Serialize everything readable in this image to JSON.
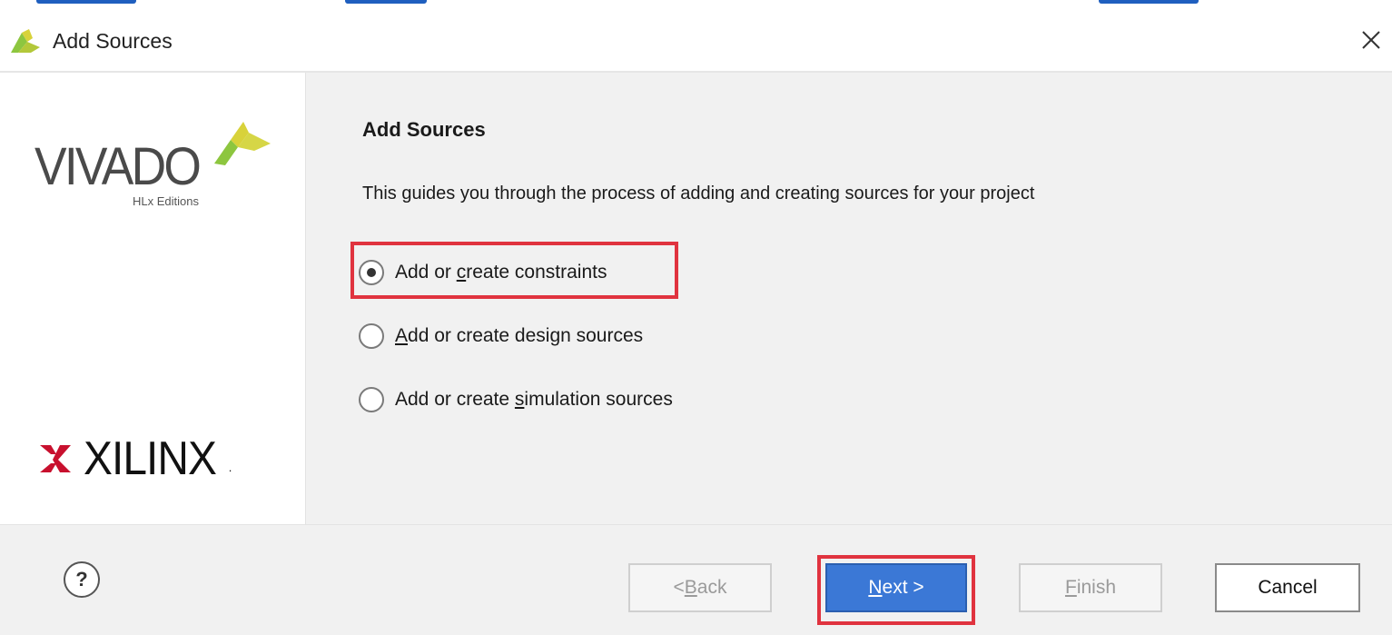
{
  "window": {
    "title": "Add Sources",
    "close_icon": "close-icon"
  },
  "brand": {
    "product": "VIVADO",
    "edition": "HLx Editions",
    "company": "XILINX",
    "company_suffix": "."
  },
  "wizard": {
    "heading": "Add Sources",
    "description": "This guides you through the process of adding and creating sources for your project",
    "options": [
      {
        "label_pre": "Add or ",
        "label_mnemonic": "c",
        "label_post": "reate constraints",
        "selected": true
      },
      {
        "label_pre": "",
        "label_mnemonic": "A",
        "label_post": "dd or create design sources",
        "selected": false
      },
      {
        "label_pre": "Add or create ",
        "label_mnemonic": "s",
        "label_post": "imulation sources",
        "selected": false
      }
    ]
  },
  "footer": {
    "help_label": "?",
    "back": {
      "pre": "< ",
      "mnemonic": "B",
      "post": "ack",
      "enabled": false
    },
    "next": {
      "pre": "",
      "mnemonic": "N",
      "post": "ext >",
      "enabled": true
    },
    "finish": {
      "pre": "",
      "mnemonic": "F",
      "post": "inish",
      "enabled": false
    },
    "cancel": {
      "label": "Cancel",
      "enabled": true
    }
  },
  "colors": {
    "accent": "#3b78d6",
    "highlight": "#e0333f",
    "vivado_green": "#8dc63f",
    "vivado_yellow": "#d8d23a",
    "xilinx_red": "#c8102e"
  }
}
